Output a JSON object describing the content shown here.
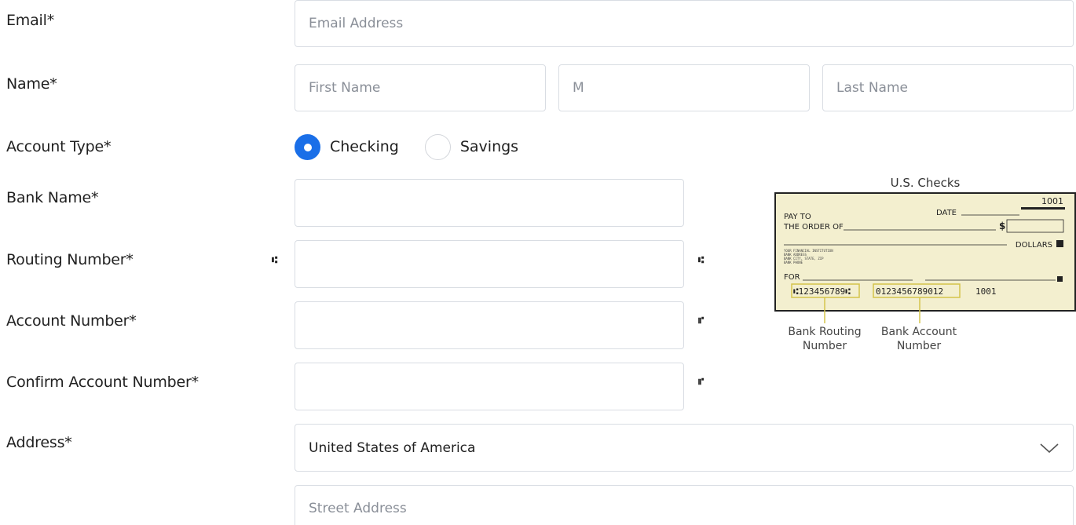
{
  "labels": {
    "email": "Email*",
    "name": "Name*",
    "account_type": "Account Type*",
    "bank_name": "Bank Name*",
    "routing_number": "Routing Number*",
    "account_number": "Account Number*",
    "confirm_account_number": "Confirm Account Number*",
    "address": "Address*"
  },
  "fields": {
    "email": {
      "placeholder": "Email Address",
      "value": ""
    },
    "first_name": {
      "placeholder": "First Name",
      "value": ""
    },
    "middle_initial": {
      "placeholder": "M",
      "value": ""
    },
    "last_name": {
      "placeholder": "Last Name",
      "value": ""
    },
    "bank_name": {
      "placeholder": "",
      "value": ""
    },
    "routing_number": {
      "placeholder": "",
      "value": ""
    },
    "account_number": {
      "placeholder": "",
      "value": ""
    },
    "confirm_account_number": {
      "placeholder": "",
      "value": ""
    },
    "street_address": {
      "placeholder": "Street Address",
      "value": ""
    }
  },
  "account_type": {
    "options": [
      {
        "label": "Checking",
        "checked": true
      },
      {
        "label": "Savings",
        "checked": false
      }
    ]
  },
  "address": {
    "country_selected": "United States of America"
  },
  "symbols": {
    "routing": "⑆",
    "account": "⑈"
  },
  "check_example": {
    "title": "U.S. Checks",
    "check_number": "1001",
    "date_label": "DATE",
    "pay_to_line1": "PAY TO",
    "pay_to_line2": "THE ORDER OF",
    "dollar_sign": "$",
    "dollars_label": "DOLLARS",
    "bank_info": [
      "YOUR FINANCIAL INSTITUTION",
      "BANK ADDRESS",
      "BANK CITY, STATE, ZIP",
      "BANK PHONE"
    ],
    "for_label": "FOR",
    "micr_routing": "⑆123456789⑆",
    "micr_account": "0123456789012",
    "micr_check": "1001",
    "caption_routing": "Bank Routing\nNumber",
    "caption_account": "Bank Account\nNumber"
  },
  "colors": {
    "accent": "#1a6fe8",
    "check_paper": "#f3efcf",
    "highlight_box": "#d4c44a"
  }
}
